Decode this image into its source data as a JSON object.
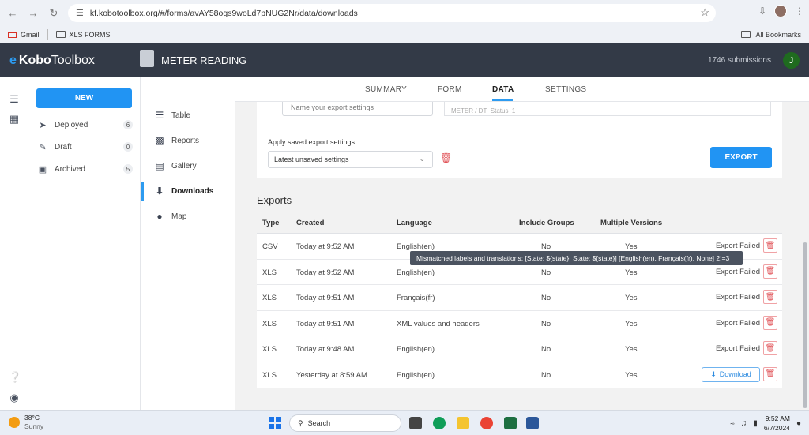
{
  "browser": {
    "url": "kf.kobotoolbox.org/#/forms/avAY58ogs9woLd7pNUG2Nr/data/downloads",
    "bookmarks": [
      "Gmail",
      "XLS FORMS"
    ],
    "all_bookmarks": "All Bookmarks"
  },
  "header": {
    "logo_mark": "e",
    "logo_bold": "Kobo",
    "logo_light": "Toolbox",
    "form_title": "METER READING",
    "submissions": "1746 submissions",
    "avatar_initial": "J"
  },
  "sidebar": {
    "new_label": "NEW",
    "items": [
      {
        "label": "Deployed",
        "count": "6"
      },
      {
        "label": "Draft",
        "count": "0"
      },
      {
        "label": "Archived",
        "count": "5"
      }
    ]
  },
  "data_menu": {
    "items": [
      {
        "label": "Table"
      },
      {
        "label": "Reports"
      },
      {
        "label": "Gallery"
      },
      {
        "label": "Downloads"
      },
      {
        "label": "Map"
      }
    ]
  },
  "tabs": [
    "SUMMARY",
    "FORM",
    "DATA",
    "SETTINGS"
  ],
  "settings": {
    "name_placeholder": "Name your export settings",
    "partial_field": "METER / DT_Status_1",
    "apply_label": "Apply saved export settings",
    "apply_value": "Latest unsaved settings",
    "export_label": "EXPORT"
  },
  "exports": {
    "title": "Exports",
    "columns": [
      "Type",
      "Created",
      "Language",
      "Include Groups",
      "Multiple Versions"
    ],
    "rows": [
      {
        "type": "CSV",
        "created": "Today at 9:52 AM",
        "language": "English(en)",
        "groups": "No",
        "versions": "Yes",
        "status": "Export Failed"
      },
      {
        "type": "XLS",
        "created": "Today at 9:52 AM",
        "language": "English(en)",
        "groups": "No",
        "versions": "Yes",
        "status": "Export Failed"
      },
      {
        "type": "XLS",
        "created": "Today at 9:51 AM",
        "language": "Français(fr)",
        "groups": "No",
        "versions": "Yes",
        "status": "Export Failed"
      },
      {
        "type": "XLS",
        "created": "Today at 9:51 AM",
        "language": "XML values and headers",
        "groups": "No",
        "versions": "Yes",
        "status": "Export Failed"
      },
      {
        "type": "XLS",
        "created": "Today at 9:48 AM",
        "language": "English(en)",
        "groups": "No",
        "versions": "Yes",
        "status": "Export Failed"
      },
      {
        "type": "XLS",
        "created": "Yesterday at 8:59 AM",
        "language": "English(en)",
        "groups": "No",
        "versions": "Yes",
        "download_label": "Download"
      }
    ],
    "tooltip": "Mismatched labels and translations: [State: ${state}, State: ${state}] [English(en), Français(fr), None] 2!=3"
  },
  "taskbar": {
    "temperature": "38°C",
    "condition": "Sunny",
    "search_label": "Search",
    "time": "9:52 AM",
    "date": "6/7/2024"
  },
  "colors": {
    "header_bg": "#333a47",
    "accent_blue": "#2194f3",
    "danger_red": "#e05055"
  }
}
